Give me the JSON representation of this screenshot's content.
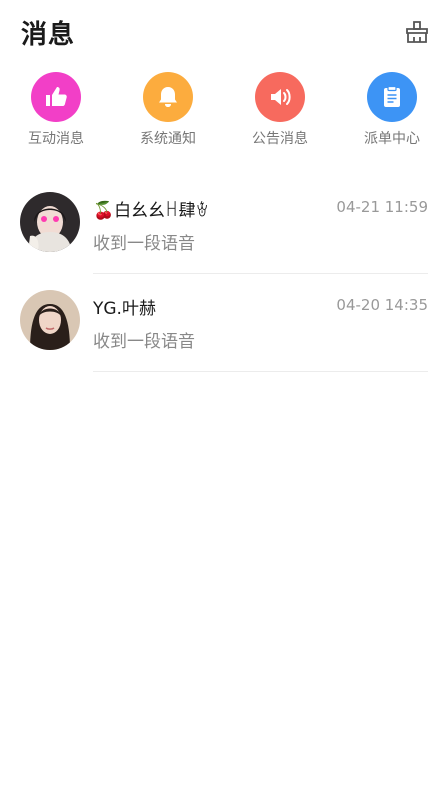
{
  "header": {
    "title": "消息"
  },
  "categories": [
    {
      "label": "互动消息",
      "color": "#f23fc7",
      "icon": "thumbs-up-icon"
    },
    {
      "label": "系统通知",
      "color": "#fcac3e",
      "icon": "bell-icon"
    },
    {
      "label": "公告消息",
      "color": "#f76a5e",
      "icon": "speaker-icon"
    },
    {
      "label": "派单中心",
      "color": "#3d94f5",
      "icon": "clipboard-icon"
    }
  ],
  "conversations": [
    {
      "name": "🍒白幺幺ꀿ肆ꄃ",
      "time": "04-21 11:59",
      "preview": "收到一段语音"
    },
    {
      "name": "YG.叶赫",
      "time": "04-20 14:35",
      "preview": "收到一段语音"
    }
  ]
}
